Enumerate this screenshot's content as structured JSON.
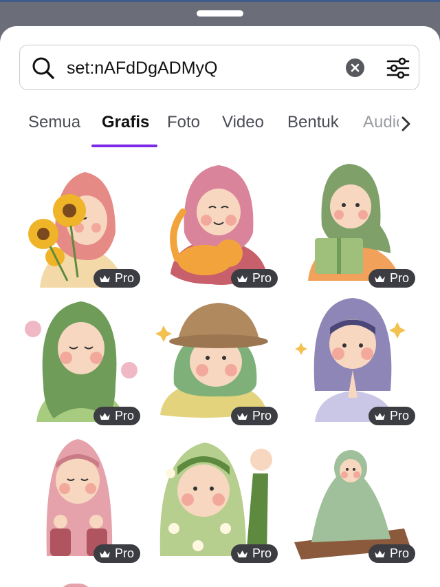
{
  "search": {
    "value": "set:nAFdDgADMyQ"
  },
  "tabs": [
    {
      "label": "Semua"
    },
    {
      "label": "Grafis"
    },
    {
      "label": "Foto"
    },
    {
      "label": "Video"
    },
    {
      "label": "Bentuk"
    },
    {
      "label": "Audio"
    }
  ],
  "active_tab": "Grafis",
  "badge": {
    "label": "Pro"
  },
  "graphics": [
    {
      "name": "girl-sunflowers",
      "hijab": "#e58a84",
      "accent": "#f0b429"
    },
    {
      "name": "girl-cat",
      "hijab": "#d9849a",
      "accent": "#f3a33b"
    },
    {
      "name": "girl-reading",
      "hijab": "#7fa068",
      "accent": "#f2a15a"
    },
    {
      "name": "girl-flowers",
      "hijab": "#6f9c58",
      "accent": "#f0b8c4"
    },
    {
      "name": "girl-hat",
      "hijab": "#7fb07a",
      "accent": "#b08a5e"
    },
    {
      "name": "girl-praying",
      "hijab": "#8f86b8",
      "accent": "#f2c14e"
    },
    {
      "name": "girl-pink",
      "hijab": "#e6a2aa",
      "accent": "#b05560"
    },
    {
      "name": "girl-floral-wave",
      "hijab": "#b7cf8e",
      "accent": "#5d8a3e"
    },
    {
      "name": "girl-prayer-mat",
      "hijab": "#9fc09a",
      "accent": "#8b5a3c"
    }
  ],
  "colors": {
    "accent": "#7d2ae8",
    "badge_bg": "#3c3d42"
  }
}
